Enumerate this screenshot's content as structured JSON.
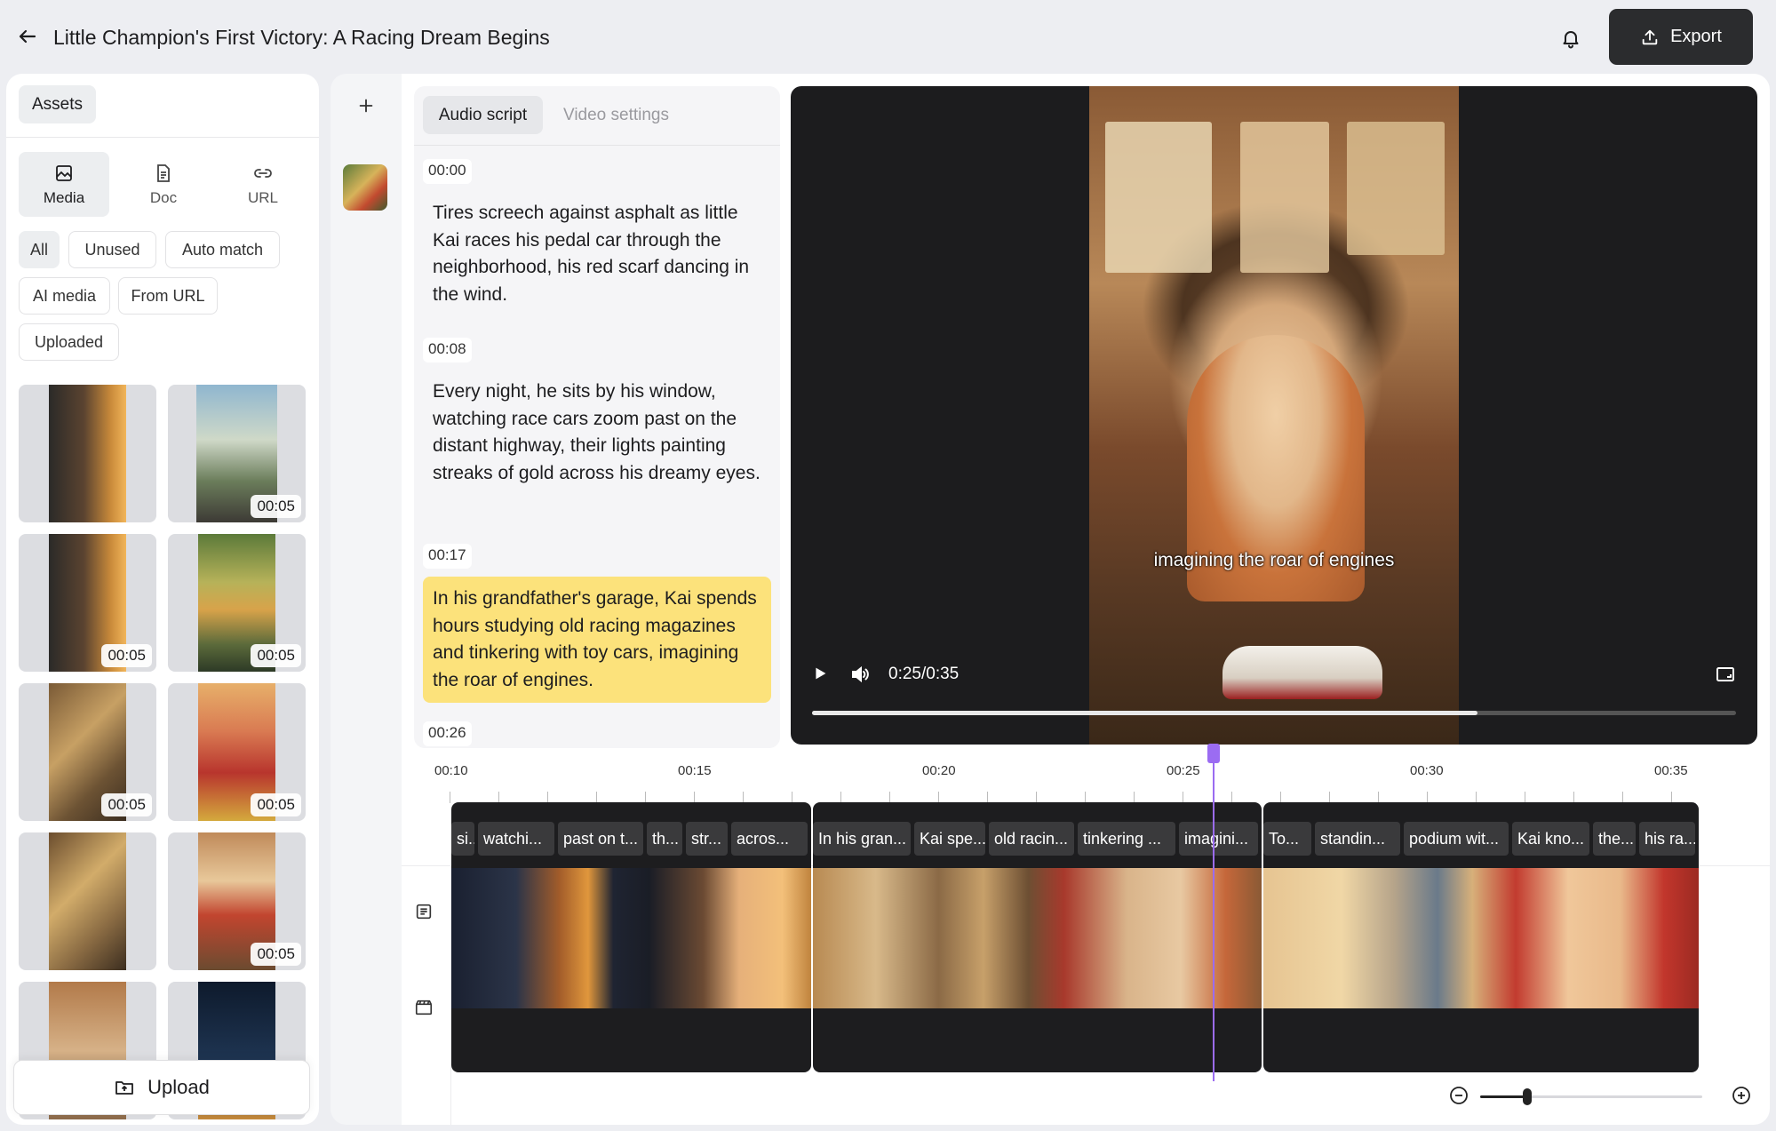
{
  "header": {
    "title": "Little Champion's First Victory: A Racing Dream Begins",
    "export_label": "Export",
    "back_icon": "arrow-left-icon",
    "bell_icon": "bell-icon"
  },
  "assets_panel": {
    "tab_label": "Assets",
    "media_tabs": [
      {
        "label": "Media",
        "icon": "image-icon",
        "active": true
      },
      {
        "label": "Doc",
        "icon": "document-icon",
        "active": false
      },
      {
        "label": "URL",
        "icon": "link-icon",
        "active": false
      }
    ],
    "filters": [
      "All",
      "Unused",
      "Auto match",
      "AI media",
      "From URL",
      "Uploaded"
    ],
    "active_filter": "All",
    "thumbnails": [
      {
        "duration": ""
      },
      {
        "duration": "00:05"
      },
      {
        "duration": "00:05"
      },
      {
        "duration": "00:05"
      },
      {
        "duration": "00:05"
      },
      {
        "duration": "00:05"
      },
      {
        "duration": ""
      },
      {
        "duration": "00:05"
      },
      {
        "duration": ""
      },
      {
        "duration": ""
      }
    ],
    "upload_label": "Upload"
  },
  "script": {
    "tabs": [
      "Audio script",
      "Video settings"
    ],
    "active_tab": "Audio script",
    "entries": [
      {
        "time": "00:00",
        "text": "Tires screech against asphalt as little Kai races his pedal car through the neighborhood, his red scarf dancing in the wind.",
        "active": false
      },
      {
        "time": "00:08",
        "text": "Every night, he sits by his window, watching race cars zoom past on the distant highway, their lights painting streaks of gold across his dreamy eyes.",
        "active": false
      },
      {
        "time": "00:17",
        "text": "In his grandfather's garage, Kai spends hours studying old racing magazines and tinkering with toy cars, imagining the roar of engines.",
        "active": true
      },
      {
        "time": "00:26",
        "text": "",
        "active": false
      }
    ]
  },
  "player": {
    "caption": "imagining the roar of engines",
    "time": "0:25/0:35",
    "progress": 0.72
  },
  "timeline": {
    "ticks": [
      "00:10",
      "00:15",
      "00:20",
      "00:25",
      "00:30",
      "00:35"
    ],
    "clips": [
      {
        "labels": [
          "si...",
          "watchi...",
          "past on t...",
          "th...",
          "str...",
          "acros..."
        ]
      },
      {
        "labels": [
          "In his gran...",
          "Kai spe...",
          "old racin...",
          "tinkering ...",
          "imagini..."
        ]
      },
      {
        "labels": [
          "To...",
          "standin...",
          "podium wit...",
          "Kai kno...",
          "the...",
          "his ra..."
        ]
      }
    ],
    "zoom_level": 0.21
  }
}
